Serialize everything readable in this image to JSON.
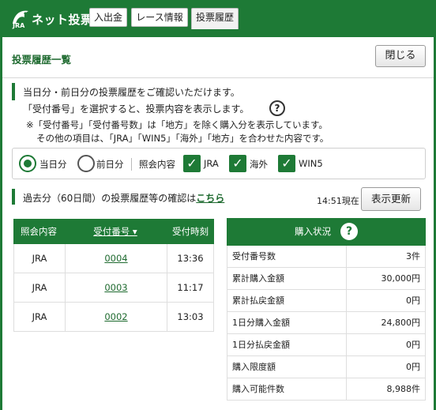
{
  "header": {
    "brand": "ネット投票",
    "brand_sub": "JRA",
    "nav": [
      "入出金",
      "レース情報",
      "投票履歴"
    ]
  },
  "page": {
    "title": "投票履歴一覧",
    "close_label": "閉じる"
  },
  "notice": {
    "line1": "当日分・前日分の投票履歴をご確認いただけます。",
    "line2": "「受付番号」を選択すると、投票内容を表示します。",
    "note1": "※「受付番号」「受付番号数」は「地方」を除く購入分を表示しています。",
    "note2": "その他の項目は、「JRA」「WIN5」「海外」「地方」を合わせた内容です。"
  },
  "filter": {
    "today_label": "当日分",
    "yesterday_label": "前日分",
    "inquiry_label": "照会内容",
    "checks": [
      "JRA",
      "海外",
      "WIN5"
    ]
  },
  "past": {
    "text": "過去分（60日間）の投票履歴等の確認は",
    "link": "こちら",
    "time_now": "14:51現在",
    "refresh_label": "表示更新"
  },
  "history": {
    "headers": [
      "照会内容",
      "受付番号 ▾",
      "受付時刻"
    ],
    "rows": [
      {
        "type": "JRA",
        "number": "0004",
        "time": "13:36"
      },
      {
        "type": "JRA",
        "number": "0003",
        "time": "11:17"
      },
      {
        "type": "JRA",
        "number": "0002",
        "time": "13:03"
      }
    ]
  },
  "status": {
    "title": "購入状況",
    "help": "?",
    "rows": [
      {
        "label": "受付番号数",
        "value": "3件"
      },
      {
        "label": "累計購入金額",
        "value": "30,000円"
      },
      {
        "label": "累計払戻金額",
        "value": "0円"
      },
      {
        "label": "1日分購入金額",
        "value": "24,800円"
      },
      {
        "label": "1日分払戻金額",
        "value": "0円"
      },
      {
        "label": "購入限度額",
        "value": "0円"
      },
      {
        "label": "購入可能件数",
        "value": "8,988件"
      }
    ]
  },
  "colors": {
    "brand_green": "#1e7a36"
  }
}
